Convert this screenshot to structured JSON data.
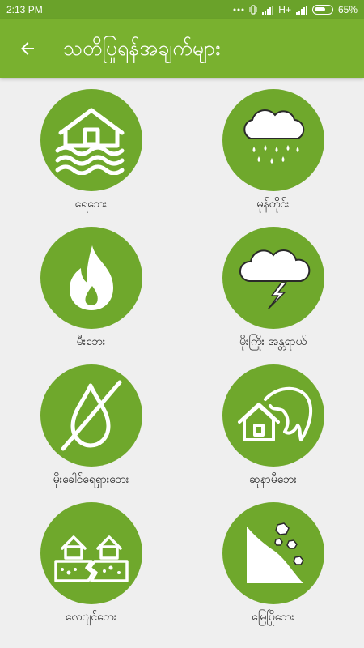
{
  "theme": {
    "accent": "#79b12f",
    "circle": "#6fa82c",
    "background": "#efefef"
  },
  "status_bar": {
    "time": "2:13 PM",
    "network_type": "H+",
    "battery": "65%",
    "icons": [
      "dots-icon",
      "vibrate-icon",
      "signal-icon",
      "battery-icon"
    ]
  },
  "header": {
    "back_icon": "arrow-left-icon",
    "title": "သတိပြုရန်အချက်များ"
  },
  "hazards": [
    {
      "label": "ရေဘေး",
      "icon": "flood-house-icon"
    },
    {
      "label": "မုန်တိုင်း",
      "icon": "storm-rain-icon"
    },
    {
      "label": "မီးဘေး",
      "icon": "fire-icon"
    },
    {
      "label": "မိုးကြိုး အန္တရာယ်",
      "icon": "lightning-cloud-icon"
    },
    {
      "label": "မိုးခေါင်ရေရှားဘေး",
      "icon": "drought-drop-icon"
    },
    {
      "label": "ဆူနာမီဘေး",
      "icon": "tsunami-wave-icon"
    },
    {
      "label": "လေျင်ဘေး",
      "icon": "earthquake-houses-icon"
    },
    {
      "label": "မြေပြိုဘေး",
      "icon": "landslide-icon"
    }
  ]
}
